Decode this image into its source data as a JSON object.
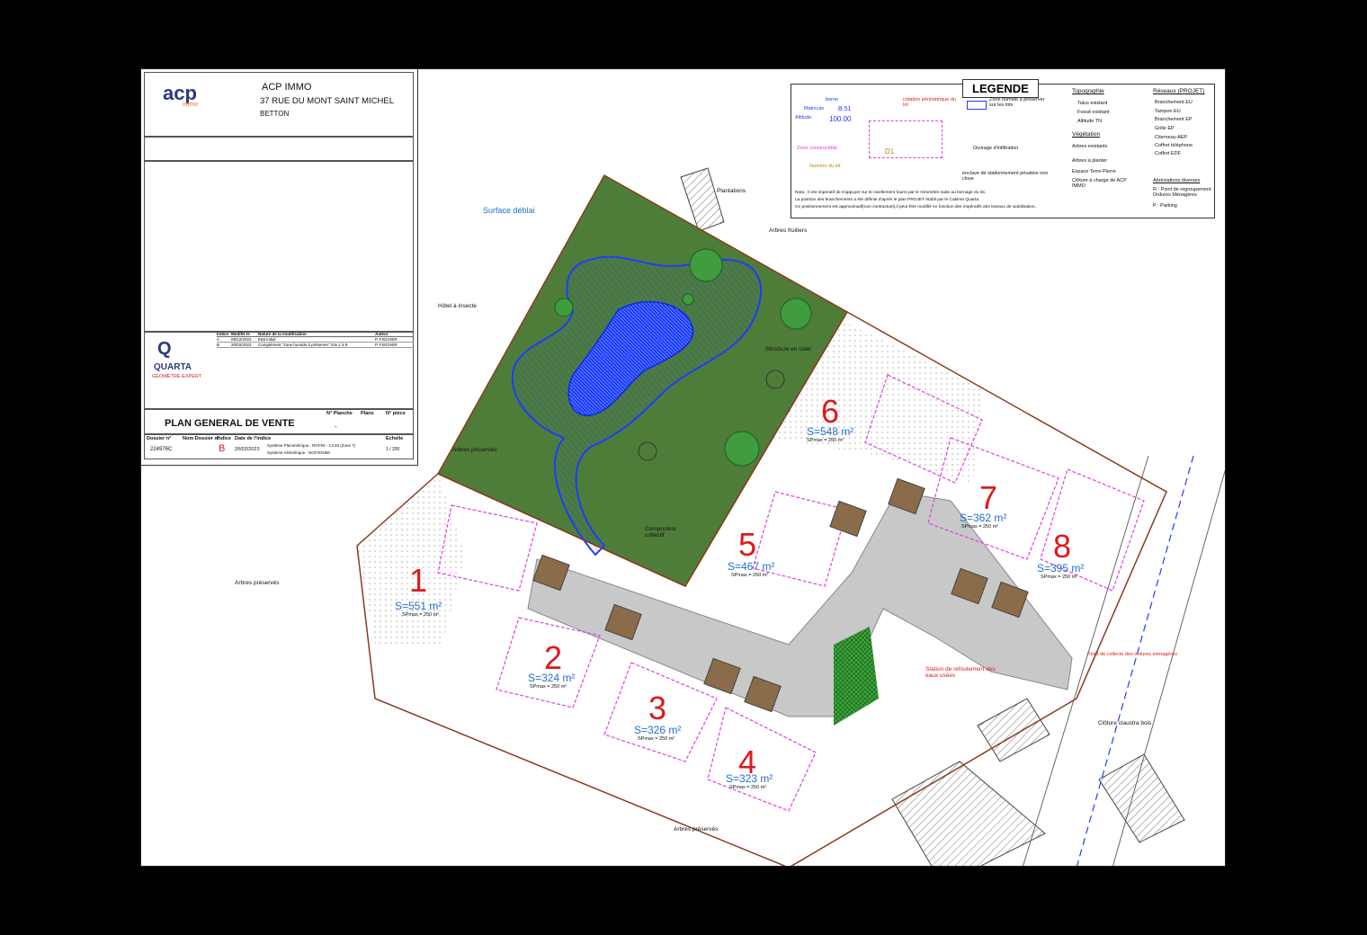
{
  "cartouche": {
    "client_name": "ACP IMMO",
    "address": "37 RUE DU MONT SAINT MICHEL",
    "city": "BETTON",
    "logo_text": "acp",
    "logo_sub": "immo",
    "surveyor": "QUARTA",
    "surveyor_sub": "GÉOMÈTRE-EXPERT",
    "plan_title": "PLAN GENERAL DE VENTE",
    "plan_value": "-",
    "headers": [
      "N° Planche",
      "Plans",
      "N° pièce"
    ],
    "dossier_headers": [
      "Dossier n°",
      "Nom Dossier n°",
      "Indice",
      "Date de l'indice",
      "",
      "Echelle"
    ],
    "dossier": "224976C",
    "indice": "B",
    "date": "20/02/2023",
    "systeme1": "Système Planimétrique : RGF93 - CC48 (Zone 7)",
    "systeme2": "Système Altimétrique : NGF/IGN69",
    "scale": "1 / 200",
    "revisions_header": [
      "Indice",
      "Modifié le",
      "Nature de la modification",
      "Auteur"
    ],
    "revisions": [
      {
        "indice": "A",
        "date": "09/12/2022",
        "nature": "Etat initial",
        "auteur": "P. FISCHER"
      },
      {
        "indice": "B",
        "date": "20/02/2023",
        "nature": "Complément \"zone humide à préserver\" lots 1 à 8",
        "auteur": "P. FISCHER"
      }
    ]
  },
  "legend": {
    "title": "LEGENDE",
    "sample": {
      "borne": "borne",
      "matricule": "Matricule",
      "altitude_label": "Altitude",
      "matricule_val": "B.51",
      "altitude_val": "100.00",
      "cotation": "cotation périmétrique du lot",
      "zone": "Zone constructible",
      "numero": "Numéro du lot",
      "lot": "D1",
      "ouvrage": "Ouvrage d'infiltration",
      "enclave": "enclave de stationnement privative non close",
      "zone_humide": "Zone humide à préserver sur les lots"
    },
    "topographie_title": "Topographie",
    "topographie": [
      "Talus existant",
      "Fossé existant",
      "Altitude TN"
    ],
    "vegetation_title": "Végétation",
    "vegetation": [
      "Arbres existants",
      "Arbres à planter",
      "Espace Terre-Pierre",
      "Clôture à charge de ACP IMMO"
    ],
    "reseaux_title": "Réseaux (PROJET)",
    "reseaux": [
      "Branchement EU",
      "Tampon EU",
      "Branchement EP",
      "Grille EP",
      "Citerneau AEP",
      "Coffret téléphone",
      "Coffret EDF"
    ],
    "abreviations_title": "Abréviations diverses",
    "abreviations": [
      "R : Point de regroupement Ordures Ménagères",
      "P : Parking"
    ],
    "note": [
      "Nota : Il est impératif de s'appuyer sur le nivellement fourni par le Géomètre suite au bornage du lot.",
      "La position des branchements a été définie d'après le plan PROJET établi par le Cabinet Quarta.",
      "Ce positionnement est approximatif(non contractuel),il peut être modifié en fonction des impératifs des travaux de viabilisation."
    ]
  },
  "annotations": {
    "plantations": "Plantations",
    "surface_deblai": "Surface déblai",
    "arbres_fruitiers": "Arbres fruitiers",
    "hotel_insecte": "Hôtel à insecte",
    "structure_osier": "Structure en osier",
    "arbres_preserves": "Arbres préservés",
    "composteur": "Composteur collectif",
    "station": "Station de refoulement des eaux usées",
    "point_collecte": "Point de collecte des ordures ménagères",
    "cloture_claustra": "Clôture claustra bois"
  },
  "lots": [
    {
      "num": "1",
      "surface": "S=551 m²",
      "spmax": "SPmax = 250 m²"
    },
    {
      "num": "2",
      "surface": "S=324 m²",
      "spmax": "SPmax = 250 m²"
    },
    {
      "num": "3",
      "surface": "S=326 m²",
      "spmax": "SPmax = 250 m²"
    },
    {
      "num": "4",
      "surface": "S=323 m²",
      "spmax": "SPmax = 250 m²"
    },
    {
      "num": "5",
      "surface": "S=467 m²",
      "spmax": "SPmax = 250 m²"
    },
    {
      "num": "6",
      "surface": "S=548 m²",
      "spmax": "SPmax = 250 m²"
    },
    {
      "num": "7",
      "surface": "S=362 m²",
      "spmax": "SPmax = 250 m²"
    },
    {
      "num": "8",
      "surface": "S=395 m²",
      "spmax": "SPmax = 250 m²"
    }
  ],
  "colors": {
    "lot_number": "#e0191a",
    "surface": "#1f6fd0",
    "green_space": "#4e7d3a",
    "wetland": "#1e3cff",
    "road": "#c8c8c8",
    "lot_outline": "#e040e0"
  }
}
